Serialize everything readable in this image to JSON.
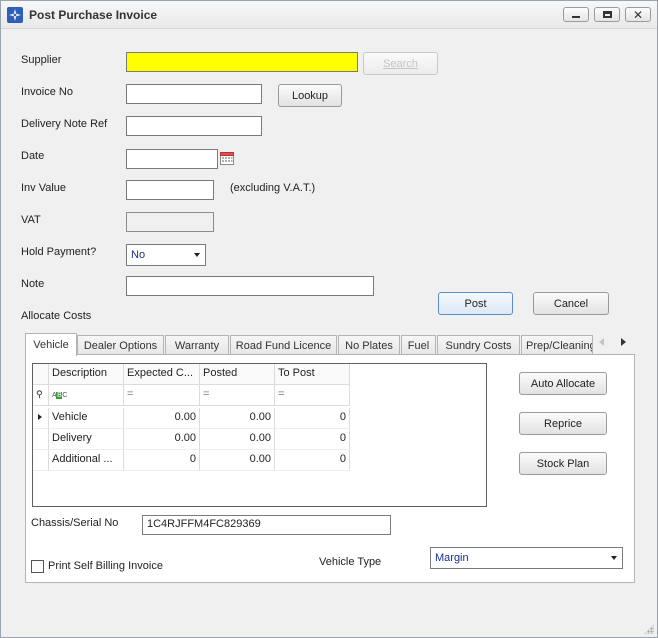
{
  "window": {
    "title": "Post Purchase Invoice"
  },
  "form": {
    "supplier_label": "Supplier",
    "supplier_value": "",
    "search_label": "Search",
    "invoice_no_label": "Invoice No",
    "invoice_no_value": "",
    "lookup_label": "Lookup",
    "delivery_note_label": "Delivery Note Ref",
    "delivery_note_value": "",
    "date_label": "Date",
    "date_value": "",
    "inv_value_label": "Inv Value",
    "inv_value_value": "",
    "inv_value_note": "(excluding V.A.T.)",
    "vat_label": "VAT",
    "vat_value": "",
    "hold_payment_label": "Hold Payment?",
    "hold_payment_value": "No",
    "note_label": "Note",
    "note_value": "",
    "allocate_costs_label": "Allocate Costs",
    "post_label": "Post",
    "cancel_label": "Cancel"
  },
  "tabs": [
    {
      "label": "Vehicle"
    },
    {
      "label": "Dealer Options"
    },
    {
      "label": "Warranty"
    },
    {
      "label": "Road Fund Licence"
    },
    {
      "label": "No Plates"
    },
    {
      "label": "Fuel"
    },
    {
      "label": "Sundry Costs"
    },
    {
      "label": "Prep/Cleaning"
    }
  ],
  "grid": {
    "columns": [
      "Description",
      "Expected C...",
      "Posted",
      "To Post"
    ],
    "filter_row": {
      "text_filter_icon": "abc-filter-icon",
      "equals_symbol": "="
    },
    "rows": [
      [
        "Vehicle",
        "0.00",
        "0.00",
        "0"
      ],
      [
        "Delivery",
        "0.00",
        "0.00",
        "0"
      ],
      [
        "Additional ...",
        "0",
        "0.00",
        "0"
      ]
    ]
  },
  "side_buttons": {
    "auto_allocate": "Auto Allocate",
    "reprice": "Reprice",
    "stock_plan": "Stock Plan"
  },
  "chassis": {
    "label": "Chassis/Serial No",
    "value": "1C4RJFFM4FC829369"
  },
  "print_self_billing": {
    "label": "Print Self Billing Invoice",
    "checked": false
  },
  "vehicle_type": {
    "label": "Vehicle Type",
    "value": "Margin"
  },
  "colors": {
    "supplier_highlight": "#ffff00",
    "accent": "#2f5fb6",
    "combo_text": "#1a2f8a"
  }
}
